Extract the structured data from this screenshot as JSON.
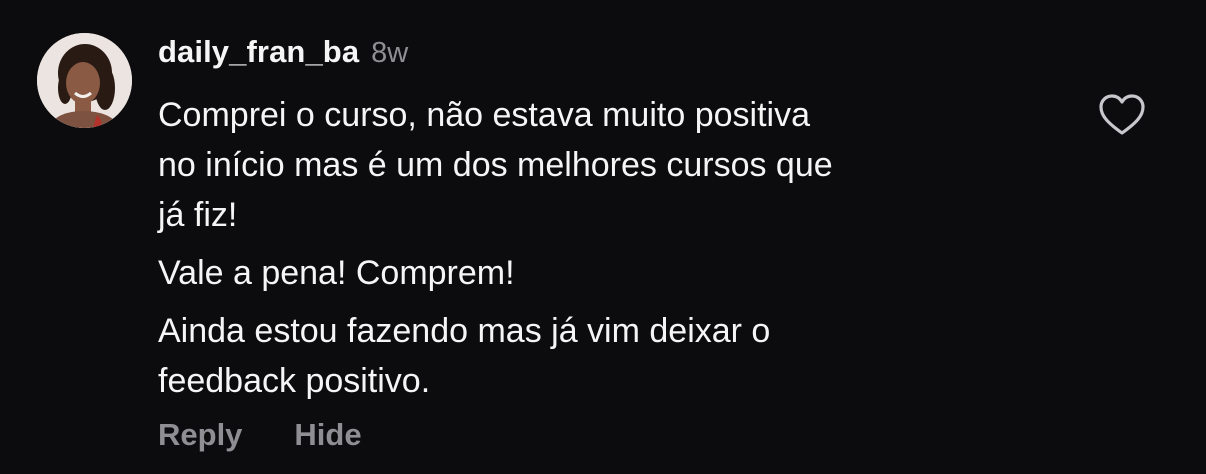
{
  "comment": {
    "username": "daily_fran_ba",
    "time": "8w",
    "paragraphs": [
      "Comprei o curso, não estava muito positiva\nno início mas é um dos melhores cursos que\njá fiz!",
      "Vale a pena! Comprem!",
      "Ainda estou fazendo mas já vim deixar o\nfeedback positivo."
    ],
    "actions": {
      "reply": "Reply",
      "hide": "Hide"
    },
    "icons": {
      "like": "heart-outline-icon",
      "avatar": "profile-photo"
    },
    "colors": {
      "background": "#0c0c0f",
      "text": "#f5f5f5",
      "muted": "#8e8e93"
    }
  }
}
